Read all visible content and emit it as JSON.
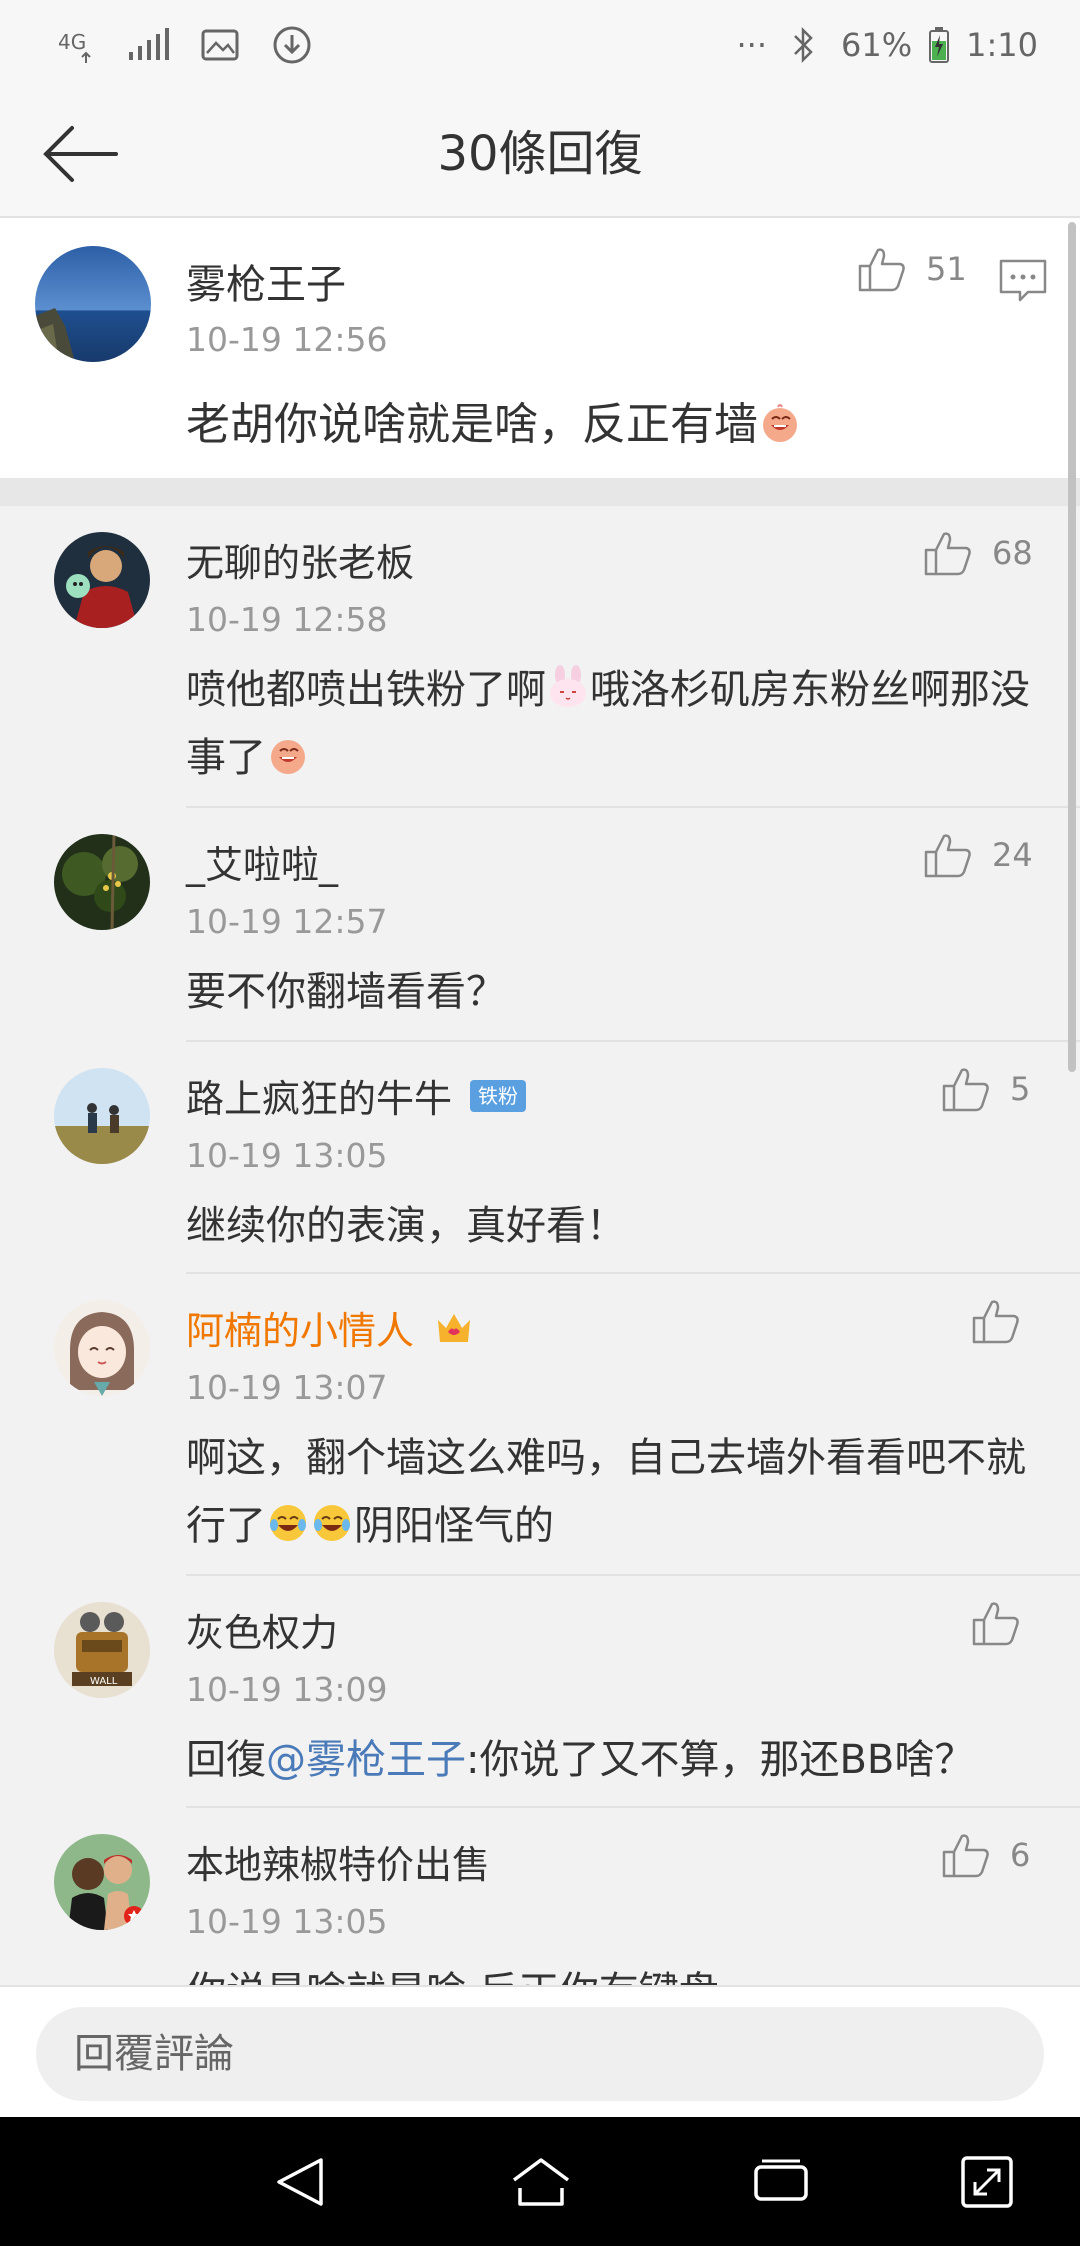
{
  "status_bar": {
    "network": "4G",
    "battery": "61%",
    "time": "1:10",
    "more": "···"
  },
  "header": {
    "title": "30條回復"
  },
  "root_comment": {
    "name": "雾枪王子",
    "time": "10-19 12:56",
    "text": "老胡你说啥就是啥，反正有墙",
    "likes": "51"
  },
  "replies": [
    {
      "name": "无聊的张老板",
      "time": "10-19 12:58",
      "text_a": "喷他都喷出铁粉了啊",
      "text_b": "哦洛杉矶房东粉丝啊那没事了",
      "likes": "68"
    },
    {
      "name": "_艾啦啦_",
      "time": "10-19 12:57",
      "text": "要不你翻墙看看？",
      "likes": "24"
    },
    {
      "name": "路上疯狂的牛牛",
      "badge": "铁粉",
      "time": "10-19 13:05",
      "text": "继续你的表演，真好看！",
      "likes": "5"
    },
    {
      "name": "阿楠的小情人",
      "time": "10-19 13:07",
      "text_a": "啊这，翻个墙这么难吗，自己去墙外看看吧不就行了",
      "text_b": "阴阳怪气的",
      "likes": ""
    },
    {
      "name": "灰色权力",
      "time": "10-19 13:09",
      "reply_prefix": "回復",
      "mention": "@雾枪王子",
      "text": ":你说了又不算，那还BB啥？",
      "likes": ""
    },
    {
      "name": "本地辣椒特价出售",
      "time": "10-19 13:05",
      "text": "你说是啥就是啥 反正你有键盘",
      "likes": "6"
    }
  ],
  "input": {
    "placeholder": "回覆評論"
  },
  "colors": {
    "vip_name": "#f07800",
    "mention": "#4a7ab8",
    "badge": "#5aa0e0"
  }
}
